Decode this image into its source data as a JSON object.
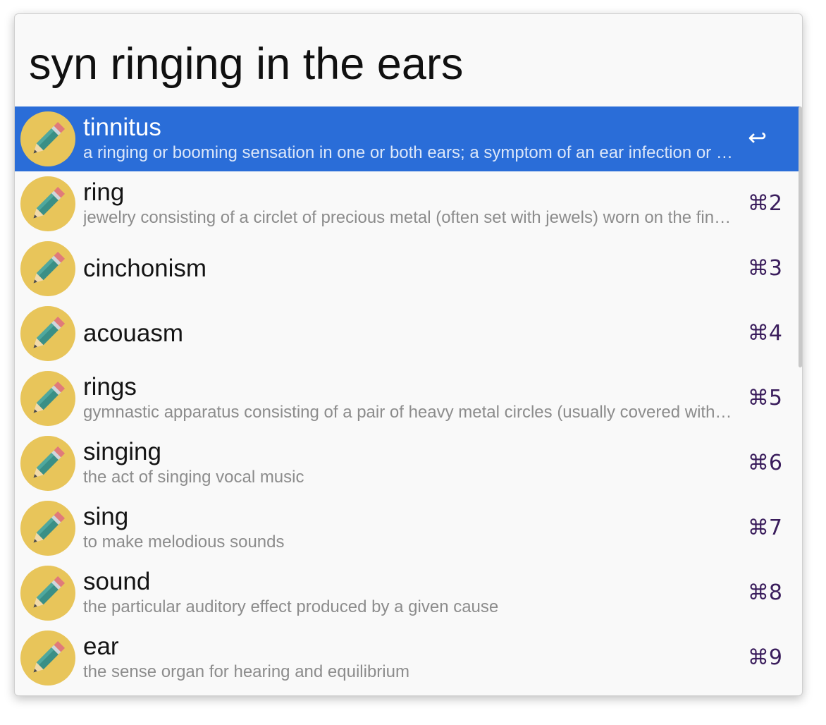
{
  "search": {
    "query": "syn ringing in the ears"
  },
  "results": [
    {
      "title": "tinnitus",
      "subtitle": "a ringing or booming sensation in one or both ears; a symptom of an ear infection or Meniere's disease",
      "shortcut": "↩",
      "selected": true
    },
    {
      "title": "ring",
      "subtitle": "jewelry consisting of a circlet of precious metal (often set with jewels) worn on the finger",
      "shortcut": "⌘2"
    },
    {
      "title": "cinchonism",
      "subtitle": "",
      "shortcut": "⌘3"
    },
    {
      "title": "acouasm",
      "subtitle": "",
      "shortcut": "⌘4"
    },
    {
      "title": "rings",
      "subtitle": "gymnastic apparatus consisting of a pair of heavy metal circles (usually covered with leather) suspended by ropes",
      "shortcut": "⌘5"
    },
    {
      "title": "singing",
      "subtitle": "the act of singing vocal music",
      "shortcut": "⌘6"
    },
    {
      "title": "sing",
      "subtitle": "to make melodious sounds",
      "shortcut": "⌘7"
    },
    {
      "title": "sound",
      "subtitle": "the particular auditory effect produced by a given cause",
      "shortcut": "⌘8"
    },
    {
      "title": "ear",
      "subtitle": "the sense organ for hearing and equilibrium",
      "shortcut": "⌘9"
    }
  ],
  "icons": {
    "result_icon": "pencil-icon"
  },
  "colors": {
    "selection": "#2a6dd8",
    "icon_background": "#e8c55a",
    "shortcut": "#3a1d5c"
  }
}
